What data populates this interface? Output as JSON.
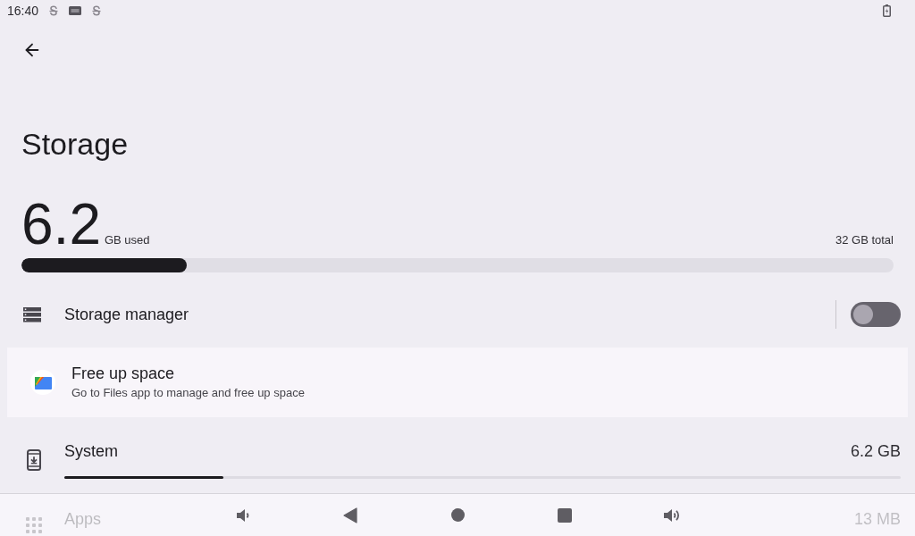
{
  "status_bar": {
    "time": "16:40"
  },
  "header": {
    "title": "Storage"
  },
  "usage": {
    "used_value": "6.2",
    "used_unit": "GB used",
    "total": "32 GB total",
    "level": 0.19
  },
  "storage_manager": {
    "label": "Storage manager",
    "on": false
  },
  "free_up_space": {
    "title": "Free up space",
    "subtitle": "Go to Files app to manage and free up space"
  },
  "categories": [
    {
      "kind": "system",
      "label": "System",
      "size": "6.2 GB",
      "level": 0.19
    },
    {
      "kind": "apps",
      "label": "Apps",
      "size": "13 MB"
    }
  ]
}
